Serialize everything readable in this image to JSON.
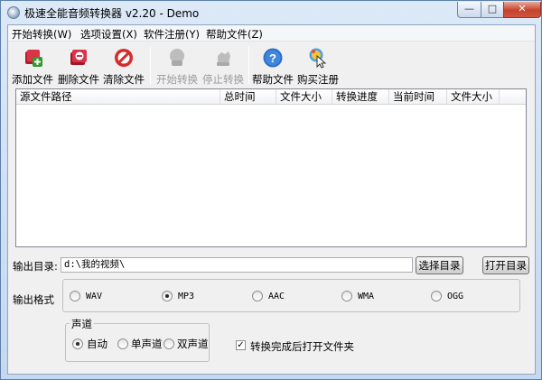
{
  "window": {
    "title": "极速全能音频转换器 v2.20 - Demo",
    "min_glyph": "—",
    "max_glyph": "□",
    "close_glyph": "✕"
  },
  "menu": [
    "开始转换(W)",
    "选项设置(X)",
    "软件注册(Y)",
    "帮助文件(Z)"
  ],
  "toolbar": {
    "add": "添加文件",
    "delete": "删除文件",
    "clear": "清除文件",
    "start": "开始转换",
    "stop": "停止转换",
    "help": "帮助文件",
    "buy": "购买注册",
    "help_glyph": "?"
  },
  "file_list": {
    "columns": [
      "源文件路径",
      "总时间",
      "文件大小",
      "转换进度",
      "当前时间",
      "文件大小"
    ],
    "rows": []
  },
  "output": {
    "dir_label": "输出目录:",
    "dir_value": "d:\\我的视频\\",
    "select_button": "选择目录",
    "open_button": "打开目录",
    "format_label": "输出格式",
    "formats": [
      "WAV",
      "MP3",
      "AAC",
      "WMA",
      "OGG"
    ],
    "selected_format": "MP3"
  },
  "channel": {
    "legend": "声道",
    "options": [
      "自动",
      "单声道",
      "双声道"
    ],
    "selected": "自动"
  },
  "open_after": {
    "label": "转换完成后打开文件夹",
    "checked": true,
    "check_glyph": "✓"
  },
  "colors": {
    "titlebar": "#dce9f7",
    "close_button": "#c7432c",
    "client_bg": "#f0f0f0"
  }
}
